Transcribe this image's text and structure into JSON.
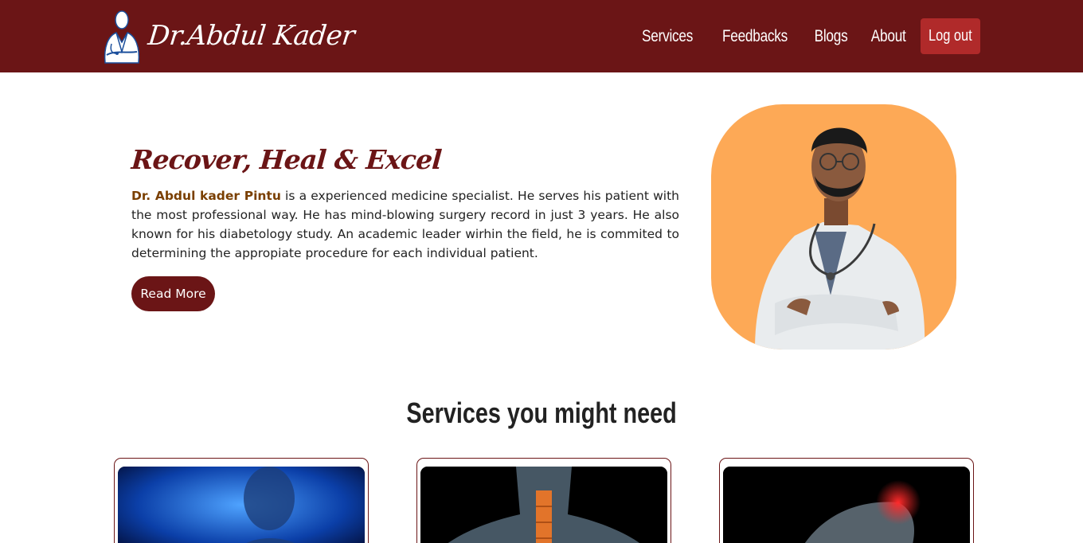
{
  "brand": {
    "name": "Dr.Abdul Kader",
    "logo_icon": "doctor-logo-icon"
  },
  "nav": {
    "items": [
      {
        "label": "Services"
      },
      {
        "label": "Feedbacks"
      },
      {
        "label": "Blogs"
      },
      {
        "label": "About"
      }
    ],
    "logout_label": "Log out"
  },
  "hero": {
    "title": "Recover, Heal & Excel",
    "doctor_name": "Dr. Abdul kader Pintu",
    "description": " is a experienced medicine specialist. He serves his patient with the most professional way. He has mind-blowing surgery record in just 3 years. He also known for his diabetology study. An academic leader wirhin the field, he is commited to determining the appropiate procedure for each individual patient.",
    "read_more_label": "Read More"
  },
  "services": {
    "title": "Services you might need"
  },
  "colors": {
    "primary": "#6b1516",
    "accent_button": "#b02a2a",
    "photo_background": "#fda956",
    "name_highlight": "#7a3f00"
  }
}
